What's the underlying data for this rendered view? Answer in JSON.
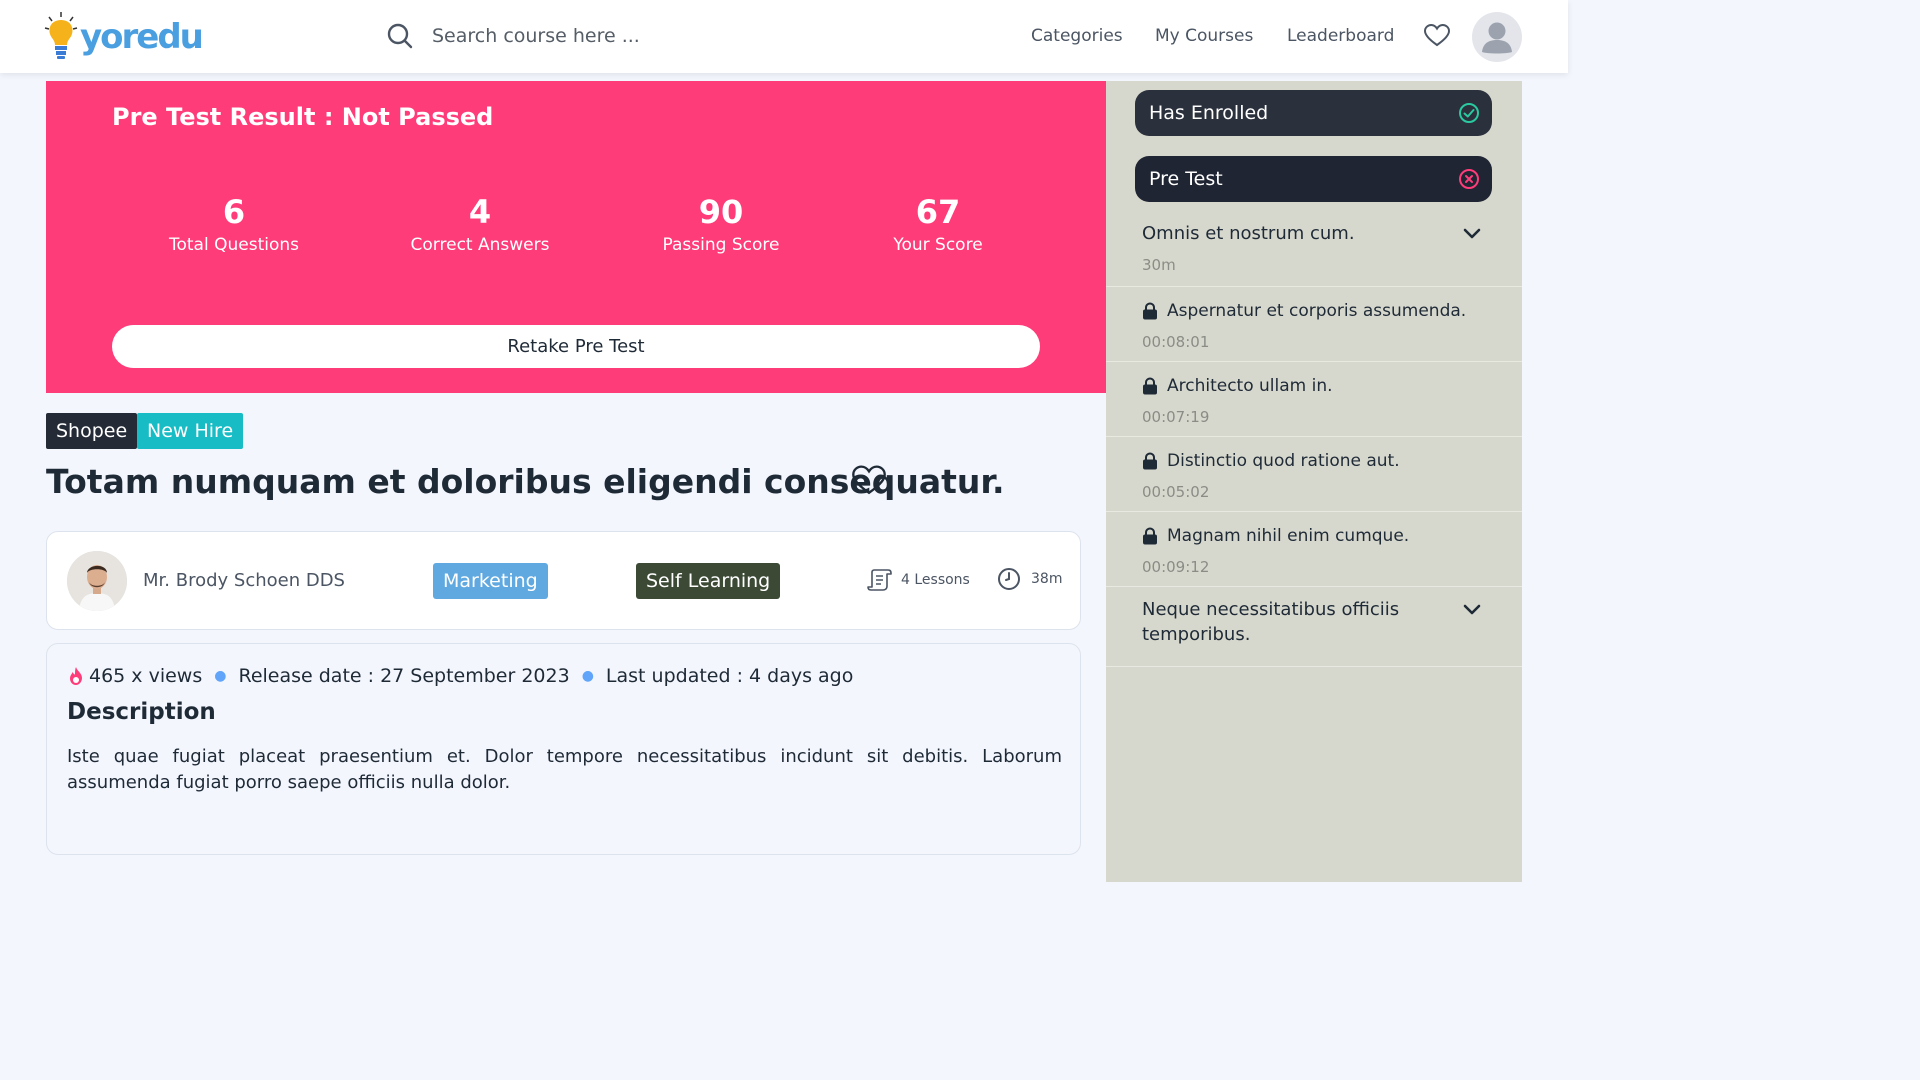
{
  "header": {
    "brand": "yoredu",
    "search_placeholder": "Search course here ...",
    "nav": [
      "Categories",
      "My Courses",
      "Leaderboard"
    ]
  },
  "result": {
    "title": "Pre Test Result : Not Passed",
    "stats": [
      {
        "value": "6",
        "label": "Total Questions"
      },
      {
        "value": "4",
        "label": "Correct Answers"
      },
      {
        "value": "90",
        "label": "Passing Score"
      },
      {
        "value": "67",
        "label": "Your Score"
      }
    ],
    "retake_label": "Retake Pre Test"
  },
  "course": {
    "tags": [
      "Shopee",
      "New Hire"
    ],
    "title": "Totam numquam et doloribus eligendi consequatur.",
    "instructor": "Mr. Brody Schoen DDS",
    "category": "Marketing",
    "type": "Self Learning",
    "lessons": "4 Lessons",
    "duration": "38m",
    "views": "465 x views",
    "release": "Release date : 27 September 2023",
    "updated": "Last updated : 4 days ago",
    "description_heading": "Description",
    "description": "Iste quae fugiat placeat praesentium et. Dolor tempore necessitatibus incidunt sit debitis. Laborum assumenda fugiat porro saepe officiis nulla dolor."
  },
  "sidebar": {
    "enrolled_label": "Has Enrolled",
    "pretest_label": "Pre Test",
    "sections": [
      {
        "title": "Omnis et nostrum cum.",
        "duration": "30m"
      },
      {
        "title": "Neque necessitatibus officiis temporibus."
      }
    ],
    "lessons": [
      {
        "title": "Aspernatur et corporis assumenda.",
        "time": "00:08:01"
      },
      {
        "title": "Architecto ullam in.",
        "time": "00:07:19"
      },
      {
        "title": "Distinctio quod ratione aut.",
        "time": "00:05:02"
      },
      {
        "title": "Magnam nihil enim cumque.",
        "time": "00:09:12"
      }
    ]
  },
  "colors": {
    "banner": "#ff3c7a",
    "brand": "#4a9fe0",
    "tag_dark": "#242a36",
    "tag_teal": "#17bcc4",
    "badge_blue": "#5fa9e0",
    "badge_green": "#3c4a35",
    "pill_dark": "#1f2532",
    "check_green": "#2bc9a0",
    "cross_pink": "#ff3c7a",
    "sidebar_bg": "#d7d8cd"
  }
}
